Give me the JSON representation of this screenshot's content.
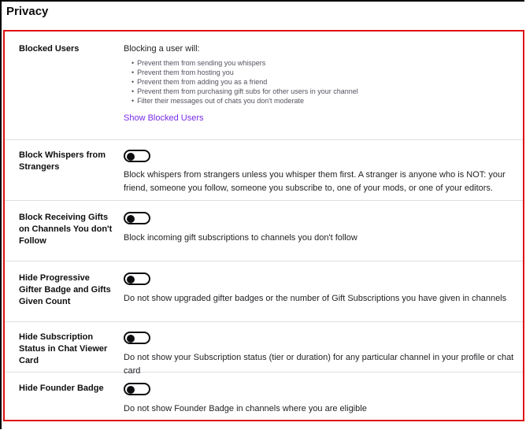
{
  "page": {
    "title": "Privacy"
  },
  "blocked_users": {
    "label": "Blocked Users",
    "intro": "Blocking a user will:",
    "bullets": [
      "Prevent them from sending you whispers",
      "Prevent them from hosting you",
      "Prevent them from adding you as a friend",
      "Prevent them from purchasing gift subs for other users in your channel",
      "Filter their messages out of chats you don't moderate"
    ],
    "link": "Show Blocked Users"
  },
  "settings": [
    {
      "label": "Block Whispers from Strangers",
      "description": "Block whispers from strangers unless you whisper them first. A stranger is anyone who is NOT: your friend, someone you follow, someone you subscribe to, one of your mods, or one of your editors.",
      "enabled": false
    },
    {
      "label": "Block Receiving Gifts on Channels You don't Follow",
      "description": "Block incoming gift subscriptions to channels you don't follow",
      "enabled": false
    },
    {
      "label": "Hide Progressive Gifter Badge and Gifts Given Count",
      "description": "Do not show upgraded gifter badges or the number of Gift Subscriptions you have given in channels",
      "enabled": false
    },
    {
      "label": "Hide Subscription Status in Chat Viewer Card",
      "description": "Do not show your Subscription status (tier or duration) for any particular channel in your profile or chat card",
      "enabled": false
    },
    {
      "label": "Hide Founder Badge",
      "description": "Do not show Founder Badge in channels where you are eligible",
      "enabled": false
    }
  ]
}
